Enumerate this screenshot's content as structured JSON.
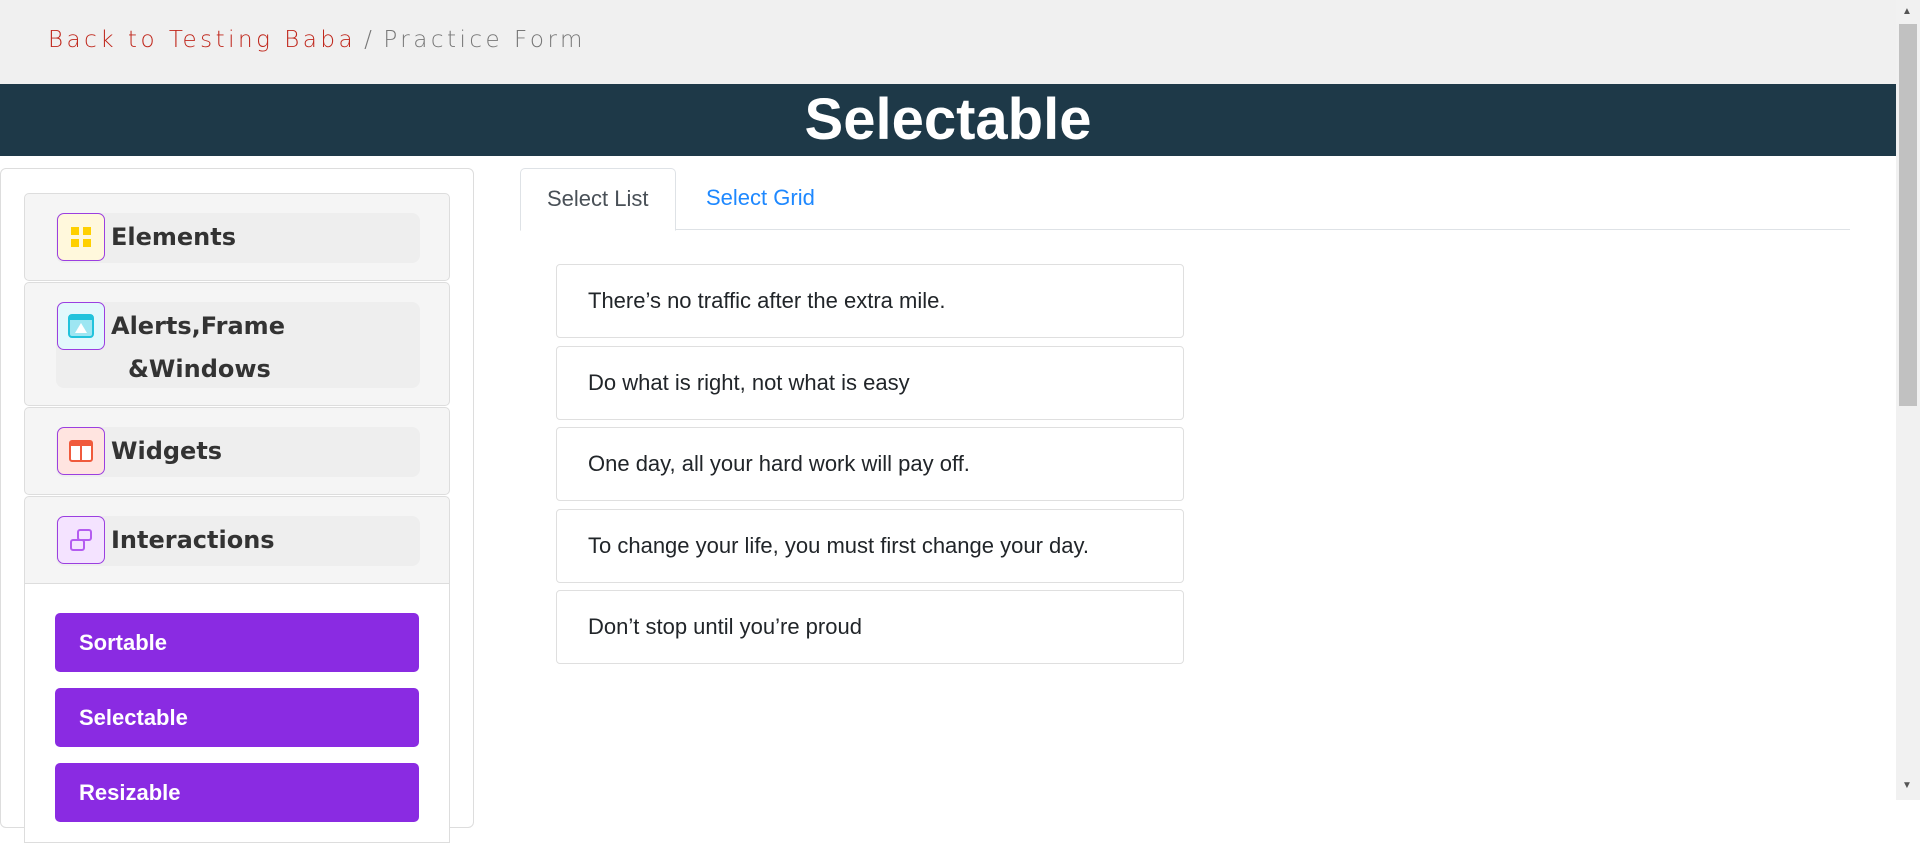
{
  "breadcrumb": {
    "back": "Back to Testing Baba",
    "separator": "/",
    "current": "Practice Form"
  },
  "page_title": "Selectable",
  "sidebar": {
    "groups": [
      {
        "label": "Elements",
        "icon": "grid-icon"
      },
      {
        "label": "Alerts,Frame",
        "label2": "&Windows",
        "icon": "alert-window-icon"
      },
      {
        "label": "Widgets",
        "icon": "widgets-icon"
      },
      {
        "label": "Interactions",
        "icon": "interactions-icon"
      }
    ],
    "items": [
      {
        "label": "Sortable"
      },
      {
        "label": "Selectable"
      },
      {
        "label": "Resizable"
      }
    ]
  },
  "tabs": [
    {
      "label": "Select List",
      "active": true
    },
    {
      "label": "Select Grid",
      "active": false
    }
  ],
  "list": [
    "There’s no traffic after the extra mile.",
    "Do what is right, not what is easy",
    "One day, all your hard work will pay off.",
    "To change your life, you must first change your day.",
    "Don’t stop until you’re proud"
  ],
  "colors": {
    "header": "#1e3948",
    "accent": "#8a2be2",
    "link": "#1e88ff",
    "back": "#c0281d"
  }
}
